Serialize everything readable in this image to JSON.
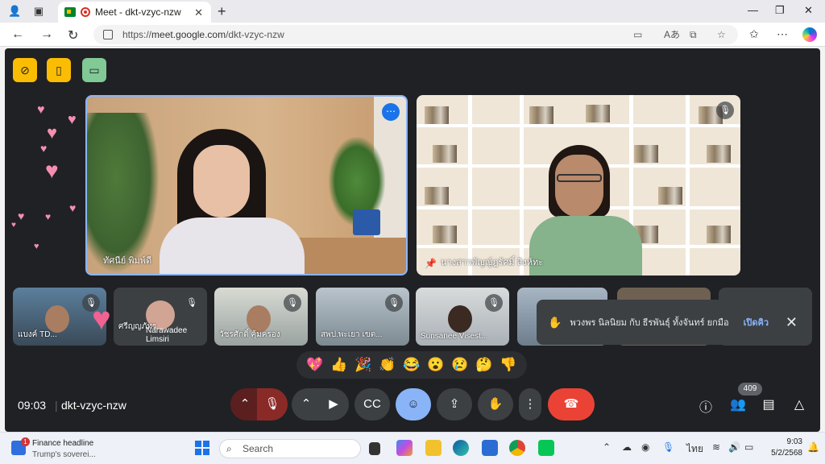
{
  "browser": {
    "tab_title": "Meet - dkt-vzyc-nzw",
    "url_prefix": "https://",
    "url_host": "meet.google.com",
    "url_path": "/dkt-vzyc-nzw"
  },
  "meeting": {
    "time": "09:03",
    "code": "dkt-vzyc-nzw",
    "participant_count": "409",
    "presenter_main": "ทัศนีย์ พิมพ์ดี",
    "pinned_speaker": "นางสาวพัญญ์ฎรัศมิ์ สิงห์ทะ"
  },
  "thumbnails": [
    {
      "name": "แบงค์ TD..."
    },
    {
      "name": "ศรีญญภัทร",
      "sub": "Narawadee Limsiri"
    },
    {
      "name": "วัชรศักดิ์ คุ้มครอง"
    },
    {
      "name": "สพป.พะเยา เขต..."
    },
    {
      "name": "Sunsanee Visest..."
    },
    {
      "name": ""
    },
    {
      "name": ""
    },
    {
      "name": ""
    }
  ],
  "raise_hand": {
    "text": "พวงพร นิลนิยม กับ ธีรพันธุ์ ทั้งจันทร์ ยกมือ",
    "action": "เปิดคิว"
  },
  "reactions": [
    "💖",
    "👍",
    "🎉",
    "👏",
    "😂",
    "😮",
    "😢",
    "🤔",
    "👎"
  ],
  "taskbar": {
    "news_title": "Finance headline",
    "news_sub": "Trump's soverei...",
    "news_badge": "1",
    "search_placeholder": "Search",
    "ime": "ไทย",
    "clock_time": "9:03",
    "clock_date": "5/2/2568"
  },
  "colors": {
    "meet_bg": "#202124",
    "accent_yellow": "#fbbc04",
    "hangup_red": "#ea4335",
    "active_blue": "#8ab4f8"
  }
}
